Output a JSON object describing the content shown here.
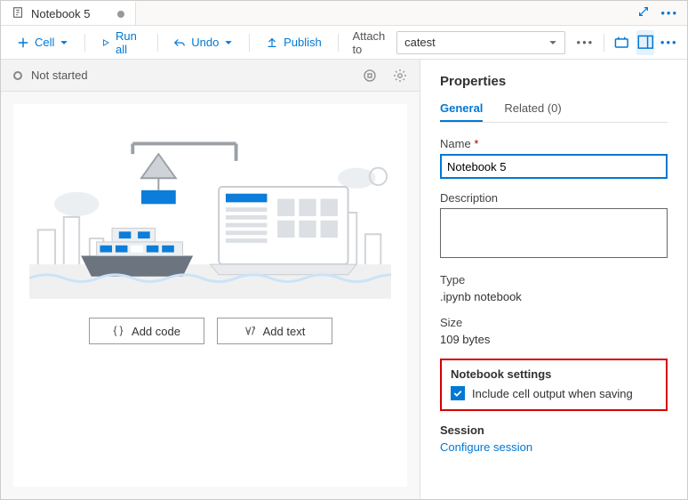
{
  "tab": {
    "title": "Notebook 5"
  },
  "toolbar": {
    "cell": "Cell",
    "runall": "Run all",
    "undo": "Undo",
    "publish": "Publish",
    "attach_label": "Attach to",
    "attach_value": "catest"
  },
  "status": {
    "text": "Not started"
  },
  "actions": {
    "add_code": "Add code",
    "add_text": "Add text"
  },
  "panel": {
    "title": "Properties",
    "tabs": {
      "general": "General",
      "related": "Related (0)"
    },
    "name_label": "Name",
    "name_value": "Notebook 5",
    "desc_label": "Description",
    "desc_value": "",
    "type_label": "Type",
    "type_value": ".ipynb notebook",
    "size_label": "Size",
    "size_value": "109 bytes",
    "settings_header": "Notebook settings",
    "include_output": "Include cell output when saving",
    "session_header": "Session",
    "configure_session": "Configure session"
  }
}
